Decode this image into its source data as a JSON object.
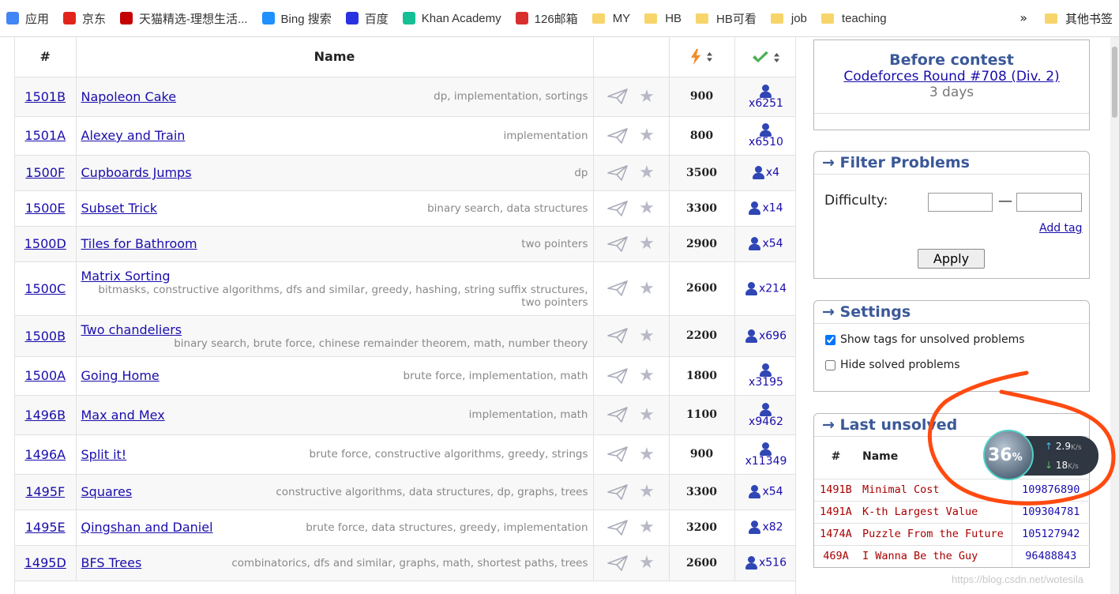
{
  "bookmarks": {
    "items": [
      {
        "label": "应用",
        "icon": "apps-grid-icon",
        "color": "#4285f4"
      },
      {
        "label": "京东",
        "icon": "jd-icon",
        "color": "#e1251b"
      },
      {
        "label": "天猫精选-理想生活...",
        "icon": "tmall-icon",
        "color": "#c40000"
      },
      {
        "label": "Bing 搜索",
        "icon": "bing-icon",
        "color": "#1e90ff"
      },
      {
        "label": "百度",
        "icon": "baidu-icon",
        "color": "#2932e1"
      },
      {
        "label": "Khan Academy",
        "icon": "khan-academy-icon",
        "color": "#14bf96"
      },
      {
        "label": "126邮箱",
        "icon": "mail-126-icon",
        "color": "#d92e2e"
      },
      {
        "label": "MY",
        "icon": "folder-icon",
        "color": "#f7d56b"
      },
      {
        "label": "HB",
        "icon": "folder-icon",
        "color": "#f7d56b"
      },
      {
        "label": "HB可看",
        "icon": "folder-icon",
        "color": "#f7d56b"
      },
      {
        "label": "job",
        "icon": "folder-icon",
        "color": "#f7d56b"
      },
      {
        "label": "teaching",
        "icon": "folder-icon",
        "color": "#f7d56b"
      }
    ],
    "more": "»",
    "other": "其他书签"
  },
  "table": {
    "headers": {
      "id": "#",
      "name": "Name"
    },
    "rows": [
      {
        "id": "1501B",
        "name": "Napoleon Cake",
        "tags": "dp, implementation, sortings",
        "rating": "900",
        "solved": "x6251",
        "h": 50,
        "stack": true,
        "two": false
      },
      {
        "id": "1501A",
        "name": "Alexey and Train",
        "tags": "implementation",
        "rating": "800",
        "solved": "x6510",
        "h": 49,
        "stack": true,
        "two": false
      },
      {
        "id": "1500F",
        "name": "Cupboards Jumps",
        "tags": "dp",
        "rating": "3500",
        "solved": "x4",
        "h": 45,
        "stack": false,
        "two": false
      },
      {
        "id": "1500E",
        "name": "Subset Trick",
        "tags": "binary search, data structures",
        "rating": "3300",
        "solved": "x14",
        "h": 45,
        "stack": false,
        "two": false
      },
      {
        "id": "1500D",
        "name": "Tiles for Bathroom",
        "tags": "two pointers",
        "rating": "2900",
        "solved": "x54",
        "h": 45,
        "stack": false,
        "two": false
      },
      {
        "id": "1500C",
        "name": "Matrix Sorting",
        "tags": "bitmasks, constructive algorithms, dfs and similar, greedy, hashing, string suffix structures, two pointers",
        "rating": "2600",
        "solved": "x214",
        "h": 68,
        "stack": false,
        "two": true
      },
      {
        "id": "1500B",
        "name": "Two chandeliers",
        "tags": "binary search, brute force, chinese remainder theorem, math, number theory",
        "rating": "2200",
        "solved": "x696",
        "h": 52,
        "stack": false,
        "two": true
      },
      {
        "id": "1500A",
        "name": "Going Home",
        "tags": "brute force, implementation, math",
        "rating": "1800",
        "solved": "x3195",
        "h": 49,
        "stack": true,
        "two": false
      },
      {
        "id": "1496B",
        "name": "Max and Mex",
        "tags": "implementation, math",
        "rating": "1100",
        "solved": "x9462",
        "h": 50,
        "stack": true,
        "two": false
      },
      {
        "id": "1496A",
        "name": "Split it!",
        "tags": "brute force, constructive algorithms, greedy, strings",
        "rating": "900",
        "solved": "x11349",
        "h": 50,
        "stack": true,
        "two": false
      },
      {
        "id": "1495F",
        "name": "Squares",
        "tags": "constructive algorithms, data structures, dp, graphs, trees",
        "rating": "3300",
        "solved": "x54",
        "h": 45,
        "stack": false,
        "two": false
      },
      {
        "id": "1495E",
        "name": "Qingshan and Daniel",
        "tags": "brute force, data structures, greedy, implementation",
        "rating": "3200",
        "solved": "x82",
        "h": 45,
        "stack": false,
        "two": false
      },
      {
        "id": "1495D",
        "name": "BFS Trees",
        "tags": "combinatorics, dfs and similar, graphs, math, shortest paths, trees",
        "rating": "2600",
        "solved": "x516",
        "h": 45,
        "stack": false,
        "two": false
      }
    ]
  },
  "contest": {
    "title": "Before contest",
    "round": "Codeforces Round #708 (Div. 2)",
    "time": "3 days"
  },
  "filter": {
    "title": "→ Filter Problems",
    "difficulty": "Difficulty:",
    "dash": "—",
    "add_tag": "Add tag",
    "apply": "Apply"
  },
  "settings": {
    "title": "→ Settings",
    "show_tags": "Show tags for unsolved problems",
    "hide_solved": "Hide solved problems",
    "show_tags_checked": true,
    "hide_solved_checked": false
  },
  "last_unsolved": {
    "title": "→ Last unsolved",
    "headers": {
      "num": "#",
      "name": "Name"
    },
    "rows": [
      {
        "id": "1491B",
        "name": "Minimal Cost",
        "sub": "109876890"
      },
      {
        "id": "1491A",
        "name": "K-th Largest Value",
        "sub": "109304781"
      },
      {
        "id": "1474A",
        "name": "Puzzle From the Future",
        "sub": "105127942"
      },
      {
        "id": "469A",
        "name": "I Wanna Be the Guy",
        "sub": "96488843"
      }
    ]
  },
  "speed_widget": {
    "percent": "36",
    "percent_sign": "%",
    "up": "2.9",
    "down": "18",
    "unit": "K/s"
  },
  "watermark": "https://blog.csdn.net/wotesila",
  "colors": {
    "link": "#1a0dab",
    "caption": "#3b5998",
    "overlay": "#ff4a10",
    "tag": "#888888"
  }
}
